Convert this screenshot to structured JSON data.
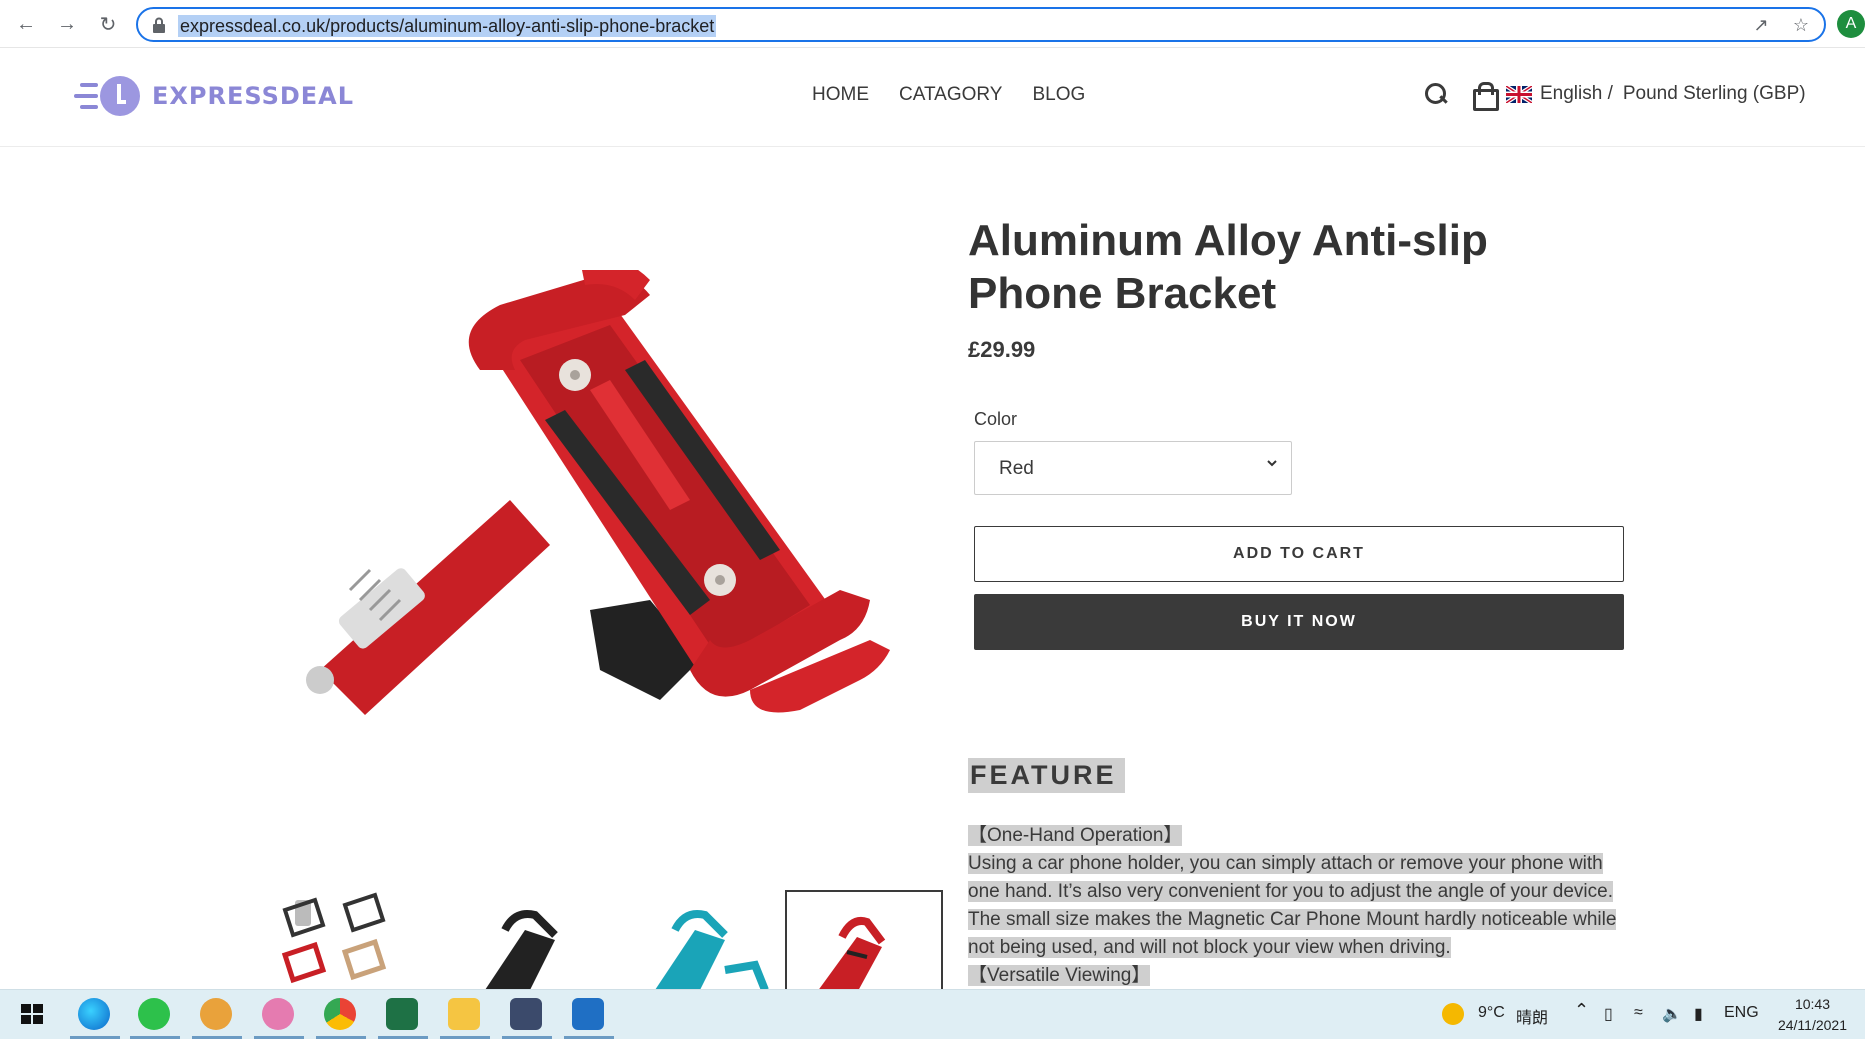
{
  "browser": {
    "url": "expressdeal.co.uk/products/aluminum-alloy-anti-slip-phone-bracket",
    "profile_initial": "A"
  },
  "site": {
    "logo_text": "EXPRESSDEAL",
    "nav": [
      "HOME",
      "CATAGORY",
      "BLOG"
    ],
    "language": "English /",
    "currency": "Pound Sterling (GBP)"
  },
  "product": {
    "title": "Aluminum Alloy Anti-slip Phone Bracket",
    "price": "£29.99",
    "color_label": "Color",
    "color_value": "Red",
    "add_to_cart": "ADD TO CART",
    "buy_now": "BUY IT NOW",
    "feature_heading": "FEATURE",
    "description": [
      "【One-Hand Operation】",
      "Using a car phone holder, you can simply attach or remove your phone with",
      "one hand. It’s also very convenient for you to adjust the angle of your device.",
      "The small size makes the Magnetic Car Phone Mount hardly noticeable while",
      "not being used, and will not block your view when driving.",
      "【Versatile Viewing】"
    ]
  },
  "taskbar": {
    "weather": "9°C",
    "weather_text": "晴朗",
    "lang": "ENG",
    "time": "10:43",
    "date": "24/11/2021"
  },
  "colors": {
    "accent": "#1a73e8",
    "brand": "#8b87d6",
    "button_dark": "#3a3a3a",
    "product_red": "#d4242a"
  }
}
